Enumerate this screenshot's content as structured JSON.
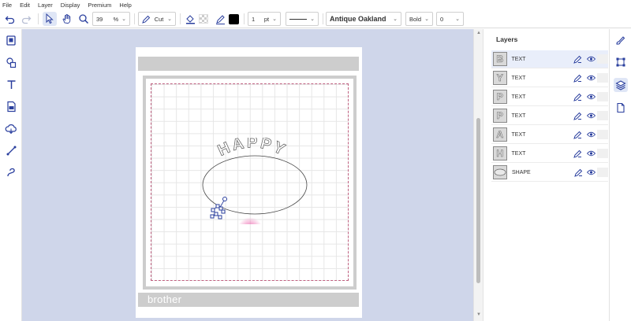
{
  "menu": [
    "File",
    "Edit",
    "Layer",
    "Display",
    "Premium",
    "Help"
  ],
  "toolbar": {
    "zoom_value": "39",
    "zoom_unit": "%",
    "mode_label": "Cut",
    "line_width_value": "1",
    "line_width_unit": "pt",
    "font_name": "Antique Oakland",
    "font_style": "Bold",
    "letter_spacing": "0",
    "fill_color": "#000000"
  },
  "canvas": {
    "mat_brand": "brother",
    "arc_text": "HAPPY"
  },
  "layers": {
    "title": "Layers",
    "items": [
      {
        "thumb": "B",
        "label": "TEXT"
      },
      {
        "thumb": "Y",
        "label": "TEXT"
      },
      {
        "thumb": "P",
        "label": "TEXT"
      },
      {
        "thumb": "P",
        "label": "TEXT"
      },
      {
        "thumb": "A",
        "label": "TEXT"
      },
      {
        "thumb": "H",
        "label": "TEXT"
      },
      {
        "thumb": "",
        "label": "SHAPE"
      }
    ]
  },
  "colors": {
    "accent": "#2a3f9e",
    "canvas_bg": "#cfd6ea",
    "cursor_highlight": "#e8409a"
  }
}
